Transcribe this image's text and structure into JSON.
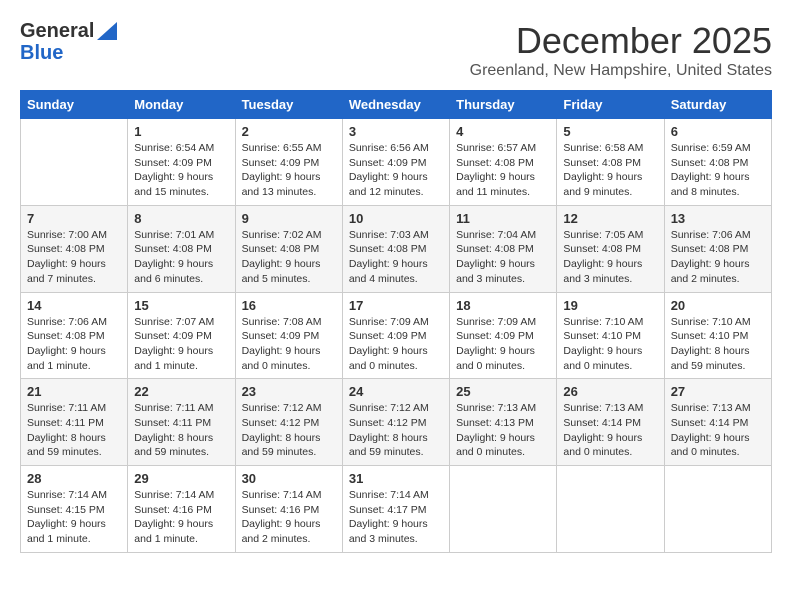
{
  "header": {
    "logo_general": "General",
    "logo_blue": "Blue",
    "month_title": "December 2025",
    "subtitle": "Greenland, New Hampshire, United States"
  },
  "days_of_week": [
    "Sunday",
    "Monday",
    "Tuesday",
    "Wednesday",
    "Thursday",
    "Friday",
    "Saturday"
  ],
  "weeks": [
    [
      {
        "day": "",
        "info": ""
      },
      {
        "day": "1",
        "info": "Sunrise: 6:54 AM\nSunset: 4:09 PM\nDaylight: 9 hours\nand 15 minutes."
      },
      {
        "day": "2",
        "info": "Sunrise: 6:55 AM\nSunset: 4:09 PM\nDaylight: 9 hours\nand 13 minutes."
      },
      {
        "day": "3",
        "info": "Sunrise: 6:56 AM\nSunset: 4:09 PM\nDaylight: 9 hours\nand 12 minutes."
      },
      {
        "day": "4",
        "info": "Sunrise: 6:57 AM\nSunset: 4:08 PM\nDaylight: 9 hours\nand 11 minutes."
      },
      {
        "day": "5",
        "info": "Sunrise: 6:58 AM\nSunset: 4:08 PM\nDaylight: 9 hours\nand 9 minutes."
      },
      {
        "day": "6",
        "info": "Sunrise: 6:59 AM\nSunset: 4:08 PM\nDaylight: 9 hours\nand 8 minutes."
      }
    ],
    [
      {
        "day": "7",
        "info": "Sunrise: 7:00 AM\nSunset: 4:08 PM\nDaylight: 9 hours\nand 7 minutes."
      },
      {
        "day": "8",
        "info": "Sunrise: 7:01 AM\nSunset: 4:08 PM\nDaylight: 9 hours\nand 6 minutes."
      },
      {
        "day": "9",
        "info": "Sunrise: 7:02 AM\nSunset: 4:08 PM\nDaylight: 9 hours\nand 5 minutes."
      },
      {
        "day": "10",
        "info": "Sunrise: 7:03 AM\nSunset: 4:08 PM\nDaylight: 9 hours\nand 4 minutes."
      },
      {
        "day": "11",
        "info": "Sunrise: 7:04 AM\nSunset: 4:08 PM\nDaylight: 9 hours\nand 3 minutes."
      },
      {
        "day": "12",
        "info": "Sunrise: 7:05 AM\nSunset: 4:08 PM\nDaylight: 9 hours\nand 3 minutes."
      },
      {
        "day": "13",
        "info": "Sunrise: 7:06 AM\nSunset: 4:08 PM\nDaylight: 9 hours\nand 2 minutes."
      }
    ],
    [
      {
        "day": "14",
        "info": "Sunrise: 7:06 AM\nSunset: 4:08 PM\nDaylight: 9 hours\nand 1 minute."
      },
      {
        "day": "15",
        "info": "Sunrise: 7:07 AM\nSunset: 4:09 PM\nDaylight: 9 hours\nand 1 minute."
      },
      {
        "day": "16",
        "info": "Sunrise: 7:08 AM\nSunset: 4:09 PM\nDaylight: 9 hours\nand 0 minutes."
      },
      {
        "day": "17",
        "info": "Sunrise: 7:09 AM\nSunset: 4:09 PM\nDaylight: 9 hours\nand 0 minutes."
      },
      {
        "day": "18",
        "info": "Sunrise: 7:09 AM\nSunset: 4:09 PM\nDaylight: 9 hours\nand 0 minutes."
      },
      {
        "day": "19",
        "info": "Sunrise: 7:10 AM\nSunset: 4:10 PM\nDaylight: 9 hours\nand 0 minutes."
      },
      {
        "day": "20",
        "info": "Sunrise: 7:10 AM\nSunset: 4:10 PM\nDaylight: 8 hours\nand 59 minutes."
      }
    ],
    [
      {
        "day": "21",
        "info": "Sunrise: 7:11 AM\nSunset: 4:11 PM\nDaylight: 8 hours\nand 59 minutes."
      },
      {
        "day": "22",
        "info": "Sunrise: 7:11 AM\nSunset: 4:11 PM\nDaylight: 8 hours\nand 59 minutes."
      },
      {
        "day": "23",
        "info": "Sunrise: 7:12 AM\nSunset: 4:12 PM\nDaylight: 8 hours\nand 59 minutes."
      },
      {
        "day": "24",
        "info": "Sunrise: 7:12 AM\nSunset: 4:12 PM\nDaylight: 8 hours\nand 59 minutes."
      },
      {
        "day": "25",
        "info": "Sunrise: 7:13 AM\nSunset: 4:13 PM\nDaylight: 9 hours\nand 0 minutes."
      },
      {
        "day": "26",
        "info": "Sunrise: 7:13 AM\nSunset: 4:14 PM\nDaylight: 9 hours\nand 0 minutes."
      },
      {
        "day": "27",
        "info": "Sunrise: 7:13 AM\nSunset: 4:14 PM\nDaylight: 9 hours\nand 0 minutes."
      }
    ],
    [
      {
        "day": "28",
        "info": "Sunrise: 7:14 AM\nSunset: 4:15 PM\nDaylight: 9 hours\nand 1 minute."
      },
      {
        "day": "29",
        "info": "Sunrise: 7:14 AM\nSunset: 4:16 PM\nDaylight: 9 hours\nand 1 minute."
      },
      {
        "day": "30",
        "info": "Sunrise: 7:14 AM\nSunset: 4:16 PM\nDaylight: 9 hours\nand 2 minutes."
      },
      {
        "day": "31",
        "info": "Sunrise: 7:14 AM\nSunset: 4:17 PM\nDaylight: 9 hours\nand 3 minutes."
      },
      {
        "day": "",
        "info": ""
      },
      {
        "day": "",
        "info": ""
      },
      {
        "day": "",
        "info": ""
      }
    ]
  ]
}
